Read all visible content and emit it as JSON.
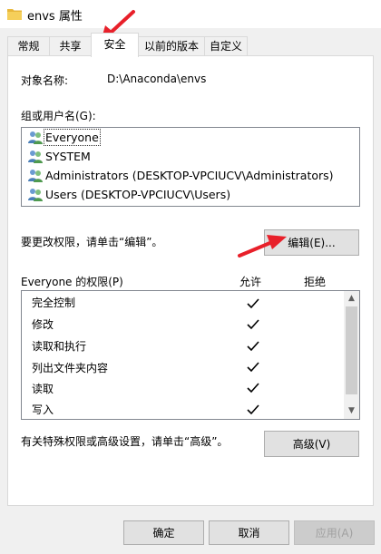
{
  "window": {
    "title": "envs 属性"
  },
  "tabs": [
    {
      "label": "常规"
    },
    {
      "label": "共享"
    },
    {
      "label": "安全"
    },
    {
      "label": "以前的版本"
    },
    {
      "label": "自定义"
    }
  ],
  "object": {
    "label": "对象名称:",
    "value": "D:\\Anaconda\\envs"
  },
  "groups": {
    "label": "组或用户名(G):",
    "items": [
      {
        "name": "Everyone"
      },
      {
        "name": "SYSTEM"
      },
      {
        "name": "Administrators (DESKTOP-VPCIUCV\\Administrators)"
      },
      {
        "name": "Users (DESKTOP-VPCIUCV\\Users)"
      }
    ]
  },
  "change": {
    "text": "要更改权限，请单击“编辑”。",
    "button": "编辑(E)..."
  },
  "permissions": {
    "label": "Everyone 的权限(P)",
    "allow_header": "允许",
    "deny_header": "拒绝",
    "items": [
      {
        "name": "完全控制",
        "allow": true,
        "deny": false
      },
      {
        "name": "修改",
        "allow": true,
        "deny": false
      },
      {
        "name": "读取和执行",
        "allow": true,
        "deny": false
      },
      {
        "name": "列出文件夹内容",
        "allow": true,
        "deny": false
      },
      {
        "name": "读取",
        "allow": true,
        "deny": false
      },
      {
        "name": "写入",
        "allow": true,
        "deny": false
      }
    ]
  },
  "advanced": {
    "text": "有关特殊权限或高级设置，请单击“高级”。",
    "button": "高级(V)"
  },
  "footer": {
    "ok": "确定",
    "cancel": "取消",
    "apply": "应用(A)"
  },
  "colors": {
    "annotation_arrow": "#e8202a",
    "folder": "#f5c542"
  }
}
